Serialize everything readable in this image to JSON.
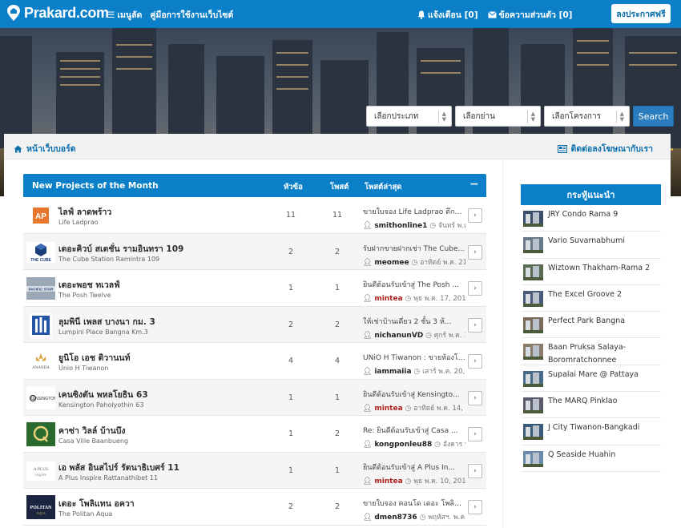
{
  "header": {
    "logo_text": "Prakard.com",
    "menu_label": "เมนูลัด",
    "guide_label": "คู่มือการใช้งานเว็บไซต์",
    "notifications_label": "แจ้งเตือน [0]",
    "messages_label": "ข้อความส่วนตัว [0]",
    "post_button": "ลงประกาศฟรี"
  },
  "search": {
    "type_select": "เลือกประเภท",
    "area_select": "เลือกย่าน",
    "project_select": "เลือกโครงการ",
    "button": "Search"
  },
  "breadcrumb": {
    "home_label": "หน้าเว็บบอร์ด",
    "contact_label": "ติดต่อลงโฆษณากับเรา"
  },
  "forum": {
    "headers": {
      "title": "New Projects of the Month",
      "topics": "หัวข้อ",
      "posts": "โพสต์",
      "latest": "โพสต์ล่าสุด",
      "collapse": "−"
    },
    "rows": [
      {
        "title": "ไลฟ์ ลาดพร้าว",
        "subtitle": "Life Ladprao",
        "topics": "11",
        "posts": "11",
        "last_title": "ขายใบจอง Life Ladprao ตึกA ...",
        "user": "smithonline1",
        "date": "จันทร์ พ.ค. 2...",
        "user_red": false,
        "thumb": "ap"
      },
      {
        "title": "เดอะคิวบ์ สเตชั่น รามอินทรา 109",
        "subtitle": "The Cube Station Ramintra 109",
        "topics": "2",
        "posts": "2",
        "last_title": "รับฝากขายฝากเช่า The Cube S...",
        "user": "meomee",
        "date": "อาทิตย์ พ.ค. 21,...",
        "user_red": false,
        "thumb": "cube"
      },
      {
        "title": "เดอะพอช ทเวลฟ์",
        "subtitle": "The Posh Twelve",
        "topics": "1",
        "posts": "1",
        "last_title": "ยินดีต้อนรับเข้าสู่ The Posh ...",
        "user": "mintea",
        "date": "พุธ พ.ค. 17, 2017...",
        "user_red": true,
        "thumb": "posh"
      },
      {
        "title": "ลุมพินี เพลส บางนา กม. 3",
        "subtitle": "Lumpini Place Bangna Km.3",
        "topics": "2",
        "posts": "2",
        "last_title": "ให้เช่าบ้านเดี่ยว 2 ชั้น 3 ห้...",
        "user": "nichanunVD",
        "date": "ศุกร์ พ.ค. 19...",
        "user_red": false,
        "thumb": "lumpini"
      },
      {
        "title": "ยูนิโอ เอช ติวานนท์",
        "subtitle": "Unio H Tiwanon",
        "topics": "4",
        "posts": "4",
        "last_title": "UNiO H Tiwanon : ขายห้องโป...",
        "user": "iammaiia",
        "date": "เสาร์ พ.ค. 20, 2...",
        "user_red": false,
        "thumb": "ananda"
      },
      {
        "title": "เคนซิงตัน พหลโยธิน 63",
        "subtitle": "Kensington Paholyothin 63",
        "topics": "1",
        "posts": "1",
        "last_title": "ยินดีต้อนรับเข้าสู่ Kensingto...",
        "user": "mintea",
        "date": "อาทิตย์ พ.ค. 14, 2...",
        "user_red": true,
        "thumb": "kens"
      },
      {
        "title": "คาซ่า วิลล์ บ้านบึง",
        "subtitle": "Casa Ville Baanbueng",
        "topics": "1",
        "posts": "2",
        "last_title": "Re: ยินดีต้อนรับเข้าสู่ Casa ...",
        "user": "kongponleu88",
        "date": "อังคาร พ...",
        "user_red": false,
        "thumb": "q"
      },
      {
        "title": "เอ พลัส อินสไปร์ รัตนาธิเบศร์ 11",
        "subtitle": "A Plus Inspire Rattanathibet 11",
        "topics": "1",
        "posts": "1",
        "last_title": "ยินดีต้อนรับเข้าสู่ A Plus In...",
        "user": "mintea",
        "date": "พุธ พ.ค. 10, 2017...",
        "user_red": true,
        "thumb": "aplus"
      },
      {
        "title": "เดอะ โพลิแทน อควา",
        "subtitle": "The Politan Aqua",
        "topics": "2",
        "posts": "2",
        "last_title": "ขายใบจอง คอนโด เดอะ โพลิแท...",
        "user": "dmen8736",
        "date": "พฤหัสฯ. พ.ค. ...",
        "user_red": false,
        "thumb": "politan"
      }
    ]
  },
  "sidebar": {
    "title": "กระทู้แนะนำ",
    "items": [
      "JRY Condo Rama 9",
      "Vario Suvarnabhumi",
      "Wiztown Thakham-Rama 2",
      "The Excel Groove 2",
      "Perfect Park Bangna",
      "Baan Pruksa Salaya-Boromratchonnee",
      "Supalai Mare @ Pattaya",
      "The MARQ Pinklao",
      "J City Tiwanon-Bangkadi",
      "Q Seaside Huahin"
    ]
  },
  "colors": {
    "brand_blue": "#0b7fc7",
    "user_red": "#b11e1e"
  }
}
